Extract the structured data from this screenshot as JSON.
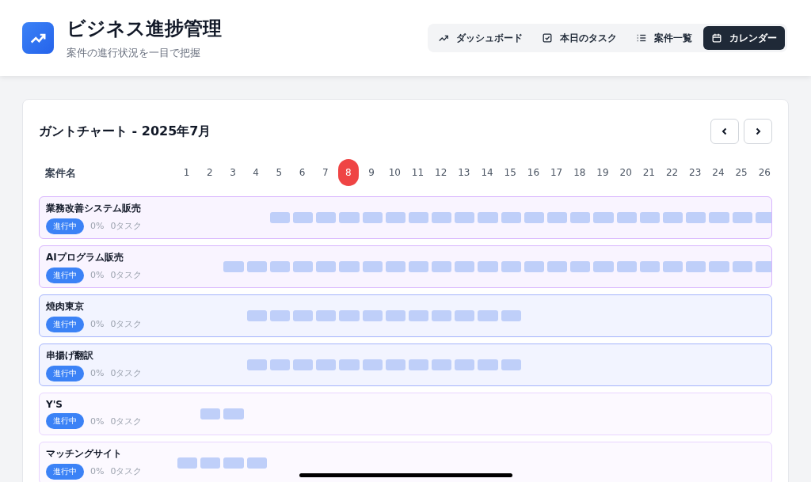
{
  "header": {
    "title": "ビジネス進捗管理",
    "subtitle": "案件の進行状況を一目で把握"
  },
  "nav": [
    {
      "label": "ダッシュボード",
      "selected": false
    },
    {
      "label": "本日のタスク",
      "selected": false
    },
    {
      "label": "案件一覧",
      "selected": false
    },
    {
      "label": "カレンダー",
      "selected": true
    }
  ],
  "gantt": {
    "title": "ガントチャート - 2025年7月",
    "name_column": "案件名",
    "days": [
      {
        "label": "1",
        "today": false
      },
      {
        "label": "2",
        "today": false
      },
      {
        "label": "3",
        "today": false
      },
      {
        "label": "4",
        "today": false
      },
      {
        "label": "5",
        "today": false
      },
      {
        "label": "6",
        "today": false
      },
      {
        "label": "7",
        "today": false
      },
      {
        "label": "8",
        "today": true
      },
      {
        "label": "9",
        "today": false
      },
      {
        "label": "10",
        "today": false
      },
      {
        "label": "11",
        "today": false
      },
      {
        "label": "12",
        "today": false
      },
      {
        "label": "13",
        "today": false
      },
      {
        "label": "14",
        "today": false
      },
      {
        "label": "15",
        "today": false
      },
      {
        "label": "16",
        "today": false
      },
      {
        "label": "17",
        "today": false
      },
      {
        "label": "18",
        "today": false
      },
      {
        "label": "19",
        "today": false
      },
      {
        "label": "20",
        "today": false
      },
      {
        "label": "21",
        "today": false
      },
      {
        "label": "22",
        "today": false
      },
      {
        "label": "23",
        "today": false
      },
      {
        "label": "24",
        "today": false
      },
      {
        "label": "25",
        "today": false
      },
      {
        "label": "26",
        "today": false
      }
    ],
    "rows": [
      {
        "name": "業務改善システム販売",
        "status": "進行中",
        "progress": "0%",
        "tasks": "0タスク",
        "color": "#d8b4fe",
        "filled": [
          false,
          false,
          false,
          false,
          true,
          true,
          true,
          true,
          true,
          true,
          true,
          true,
          true,
          true,
          true,
          true,
          true,
          true,
          true,
          true,
          true,
          true,
          true,
          true,
          true,
          true
        ]
      },
      {
        "name": "AIプログラム販売",
        "status": "進行中",
        "progress": "0%",
        "tasks": "0タスク",
        "color": "#d8b4fe",
        "filled": [
          false,
          false,
          true,
          true,
          true,
          true,
          true,
          true,
          true,
          true,
          true,
          true,
          true,
          true,
          true,
          true,
          true,
          true,
          true,
          true,
          true,
          true,
          true,
          true,
          true,
          true
        ]
      },
      {
        "name": "焼肉東京",
        "status": "進行中",
        "progress": "0%",
        "tasks": "0タスク",
        "color": "#a5b4fc",
        "filled": [
          false,
          false,
          false,
          true,
          true,
          true,
          true,
          true,
          true,
          true,
          true,
          true,
          true,
          true,
          true,
          false,
          false,
          false,
          false,
          false,
          false,
          false,
          false,
          false,
          false,
          false
        ]
      },
      {
        "name": "串揚げ翻訳",
        "status": "進行中",
        "progress": "0%",
        "tasks": "0タスク",
        "color": "#a5b4fc",
        "filled": [
          false,
          false,
          false,
          true,
          true,
          true,
          true,
          true,
          true,
          true,
          true,
          true,
          true,
          true,
          true,
          false,
          false,
          false,
          false,
          false,
          false,
          false,
          false,
          false,
          false,
          false
        ]
      },
      {
        "name": "Y'S",
        "status": "進行中",
        "progress": "0%",
        "tasks": "0タスク",
        "color": "#e9d5ff",
        "filled": [
          false,
          true,
          true,
          false,
          false,
          false,
          false,
          false,
          false,
          false,
          false,
          false,
          false,
          false,
          false,
          false,
          false,
          false,
          false,
          false,
          false,
          false,
          false,
          false,
          false,
          false
        ]
      },
      {
        "name": "マッチングサイト",
        "status": "進行中",
        "progress": "0%",
        "tasks": "0タスク",
        "color": "#e9d5ff",
        "filled": [
          true,
          true,
          true,
          true,
          false,
          false,
          false,
          false,
          false,
          false,
          false,
          false,
          false,
          false,
          false,
          false,
          false,
          false,
          false,
          false,
          false,
          false,
          false,
          false,
          false,
          false
        ]
      }
    ]
  }
}
